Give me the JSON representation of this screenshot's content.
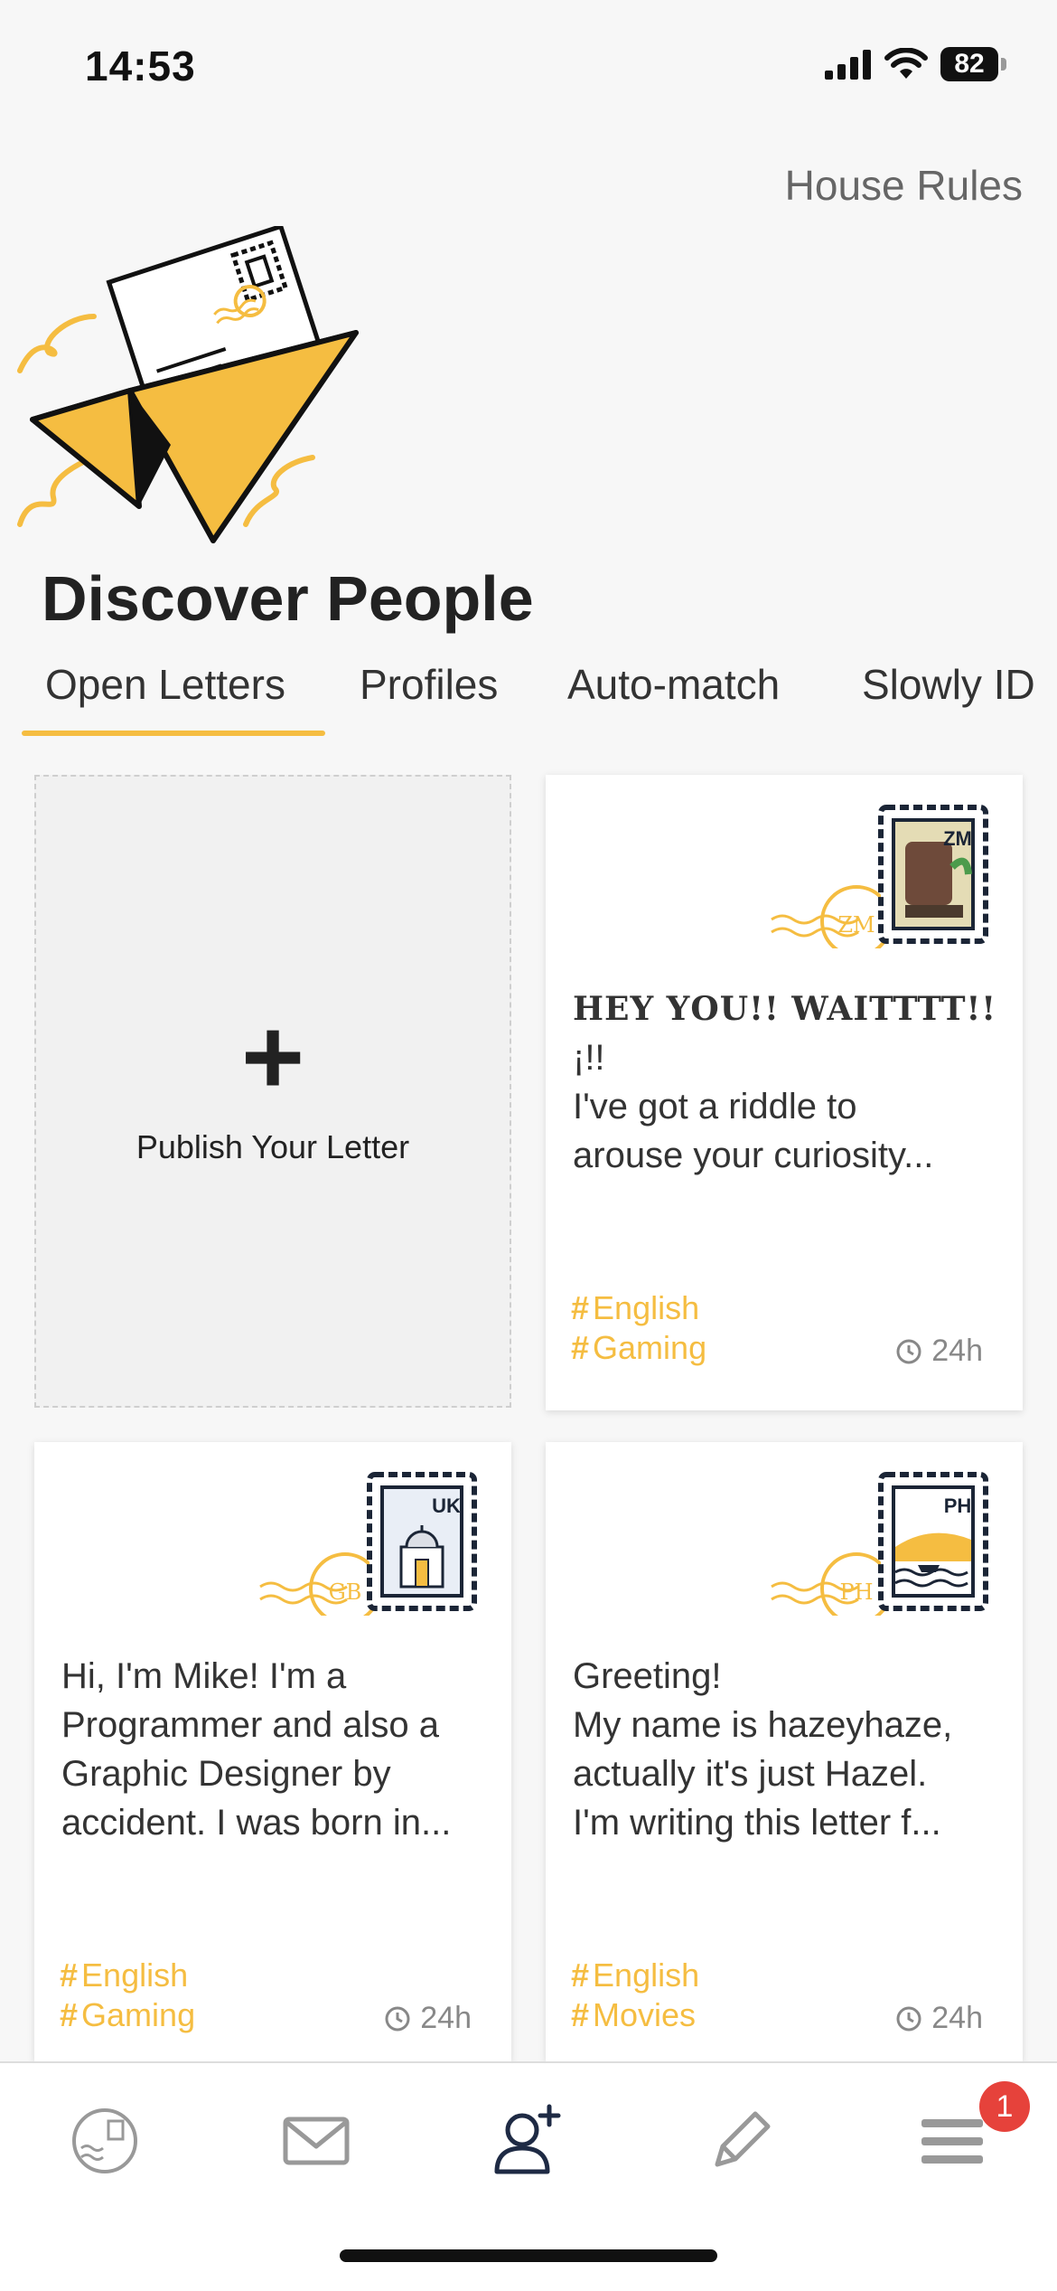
{
  "status": {
    "time": "14:53",
    "battery": "82"
  },
  "header": {
    "house_rules": "House Rules",
    "title": "Discover People"
  },
  "tabs": [
    {
      "label": "Open Letters"
    },
    {
      "label": "Profiles"
    },
    {
      "label": "Auto-match"
    },
    {
      "label": "Slowly ID"
    }
  ],
  "publish": {
    "label": "Publish Your Letter"
  },
  "letters": [
    {
      "stamp_code": "ZM",
      "postmark": "ZM",
      "title": "HEY YOU!! WAITTTT!!",
      "lines": [
        "¡!!",
        "I've got a riddle to",
        "arouse your curiosity..."
      ],
      "tags": [
        "English",
        "Gaming"
      ],
      "time": "24h"
    },
    {
      "stamp_code": "UK",
      "postmark": "GB",
      "lines": [
        "Hi, I'm Mike! I'm a",
        "Programmer and also a",
        "Graphic Designer by",
        "accident. I was born in..."
      ],
      "tags": [
        "English",
        "Gaming"
      ],
      "time": "24h"
    },
    {
      "stamp_code": "PH",
      "postmark": "PH",
      "lines": [
        "Greeting!",
        "My name is hazeyhaze,",
        "actually it's just Hazel.",
        "I'm writing this letter f..."
      ],
      "tags": [
        "English",
        "Movies"
      ],
      "time": "24h"
    }
  ],
  "nav": {
    "items": [
      "profile-stamp",
      "mail",
      "discover-people",
      "compose",
      "menu"
    ],
    "badge": "1"
  },
  "colors": {
    "accent": "#f5bd41",
    "badge": "#e6423b",
    "nav_active": "#1e2a44"
  }
}
